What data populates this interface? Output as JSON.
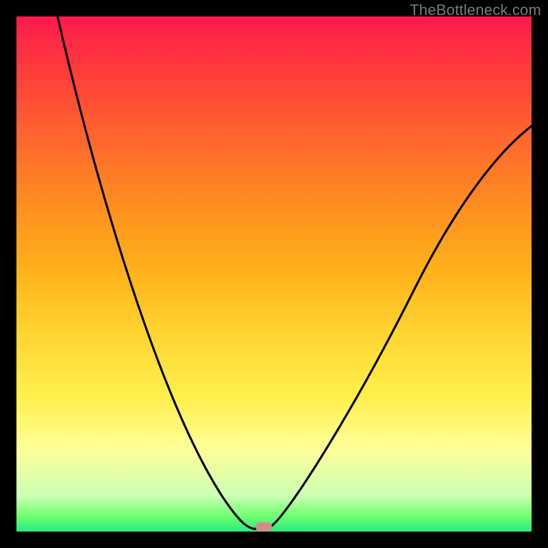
{
  "attribution": "TheBottleneck.com",
  "colors": {
    "frame": "#000000",
    "curve": "#000000",
    "marker": "#d88a8a",
    "gradient_top": "#ff1a4d",
    "gradient_mid": "#ffd633",
    "gradient_bottom": "#2bea83",
    "attribution_text": "#7a7a7a"
  },
  "chart_data": {
    "type": "line",
    "title": "",
    "xlabel": "",
    "ylabel": "",
    "xlim": [
      0,
      100
    ],
    "ylim": [
      0,
      100
    ],
    "series": [
      {
        "name": "bottleneck-curve",
        "x": [
          8,
          14,
          20,
          26,
          32,
          38,
          44,
          47,
          49,
          52,
          58,
          66,
          74,
          82,
          90,
          100
        ],
        "y": [
          100,
          86,
          70,
          54,
          38,
          22,
          8,
          2,
          0,
          2,
          12,
          30,
          48,
          62,
          72,
          79
        ]
      }
    ],
    "markers": [
      {
        "name": "optimal-point",
        "x": 48,
        "y": 0
      }
    ],
    "background_gradient": {
      "direction": "vertical",
      "stops": [
        {
          "pos": 0.0,
          "color": "#ff1a4d"
        },
        {
          "pos": 0.25,
          "color": "#ff6a2c"
        },
        {
          "pos": 0.5,
          "color": "#ffb31a"
        },
        {
          "pos": 0.74,
          "color": "#fff04d"
        },
        {
          "pos": 0.93,
          "color": "#ccffb3"
        },
        {
          "pos": 1.0,
          "color": "#2bea83"
        }
      ]
    }
  }
}
